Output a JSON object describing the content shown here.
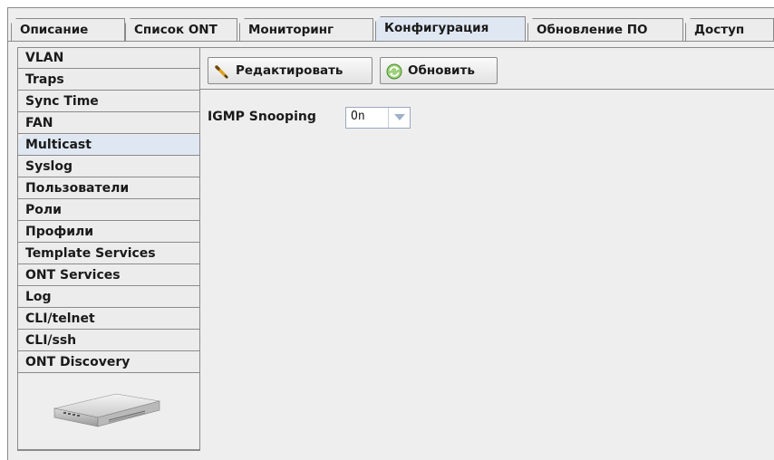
{
  "tabs": [
    {
      "label": "Описание",
      "active": false
    },
    {
      "label": "Список ONT",
      "active": false
    },
    {
      "label": "Мониторинг",
      "active": false
    },
    {
      "label": "Конфигурация",
      "active": true
    },
    {
      "label": "Обновление ПО",
      "active": false
    },
    {
      "label": "Доступ",
      "active": false
    }
  ],
  "sidebar": {
    "items": [
      {
        "label": "VLAN"
      },
      {
        "label": "Traps"
      },
      {
        "label": "Sync Time"
      },
      {
        "label": "FAN"
      },
      {
        "label": "Multicast",
        "active": true
      },
      {
        "label": "Syslog"
      },
      {
        "label": "Пользователи"
      },
      {
        "label": "Роли"
      },
      {
        "label": "Профили"
      },
      {
        "label": "Template Services"
      },
      {
        "label": "ONT Services"
      },
      {
        "label": "Log"
      },
      {
        "label": "CLI/telnet"
      },
      {
        "label": "CLI/ssh"
      },
      {
        "label": "ONT Discovery"
      }
    ]
  },
  "toolbar": {
    "edit_label": "Редактировать",
    "refresh_label": "Обновить"
  },
  "form": {
    "igmp_label": "IGMP Snooping",
    "igmp_value": "On"
  },
  "icons": {
    "edit": "pencil-icon",
    "refresh": "refresh-icon",
    "device": "olt-device-icon"
  }
}
